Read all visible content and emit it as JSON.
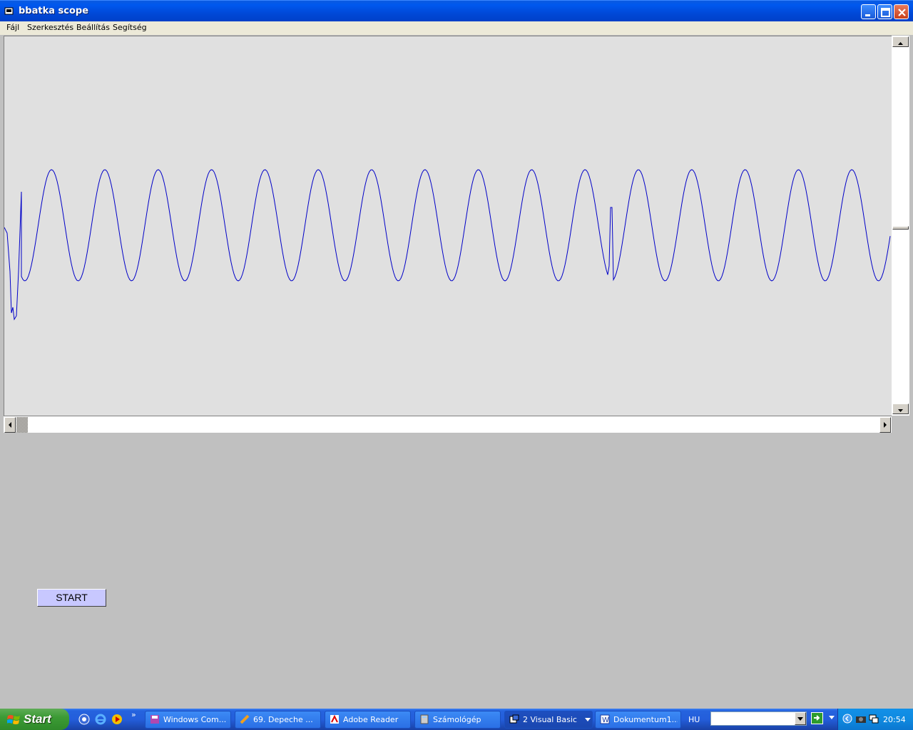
{
  "window": {
    "title": "bbatka scope",
    "icon": "app-icon"
  },
  "menu": {
    "items": [
      "Fájl",
      "Szerkesztés",
      "Beállítás",
      "Segítség"
    ]
  },
  "form": {
    "start_label": "START"
  },
  "chart_data": {
    "type": "line",
    "title": "",
    "xlabel": "",
    "ylabel": "",
    "series": [
      {
        "waveform": "sine",
        "cycles_visible": 16,
        "color": "#0000c8",
        "glitches_at_cycle": [
          0,
          11
        ]
      }
    ],
    "grid": false
  },
  "taskbar": {
    "start_label": "Start",
    "tasks": [
      {
        "label": "Windows Com...",
        "icon": "floppy-icon"
      },
      {
        "label": "69. Depeche ...",
        "icon": "music-icon"
      },
      {
        "label": "Adobe Reader",
        "icon": "pdf-icon"
      },
      {
        "label": "Számológép",
        "icon": "calculator-icon"
      },
      {
        "label": "2 Visual Basic",
        "icon": "vb-icon"
      },
      {
        "label": "Dokumentum1...",
        "icon": "word-icon"
      }
    ],
    "language": "HU",
    "clock": "20:54"
  },
  "colors": {
    "titlebar": "#0058ee",
    "trace": "#0000c8",
    "scope_bg": "#e0e0e0",
    "form_bg": "#c0c0c0",
    "start_button": "#c8c8ff"
  }
}
